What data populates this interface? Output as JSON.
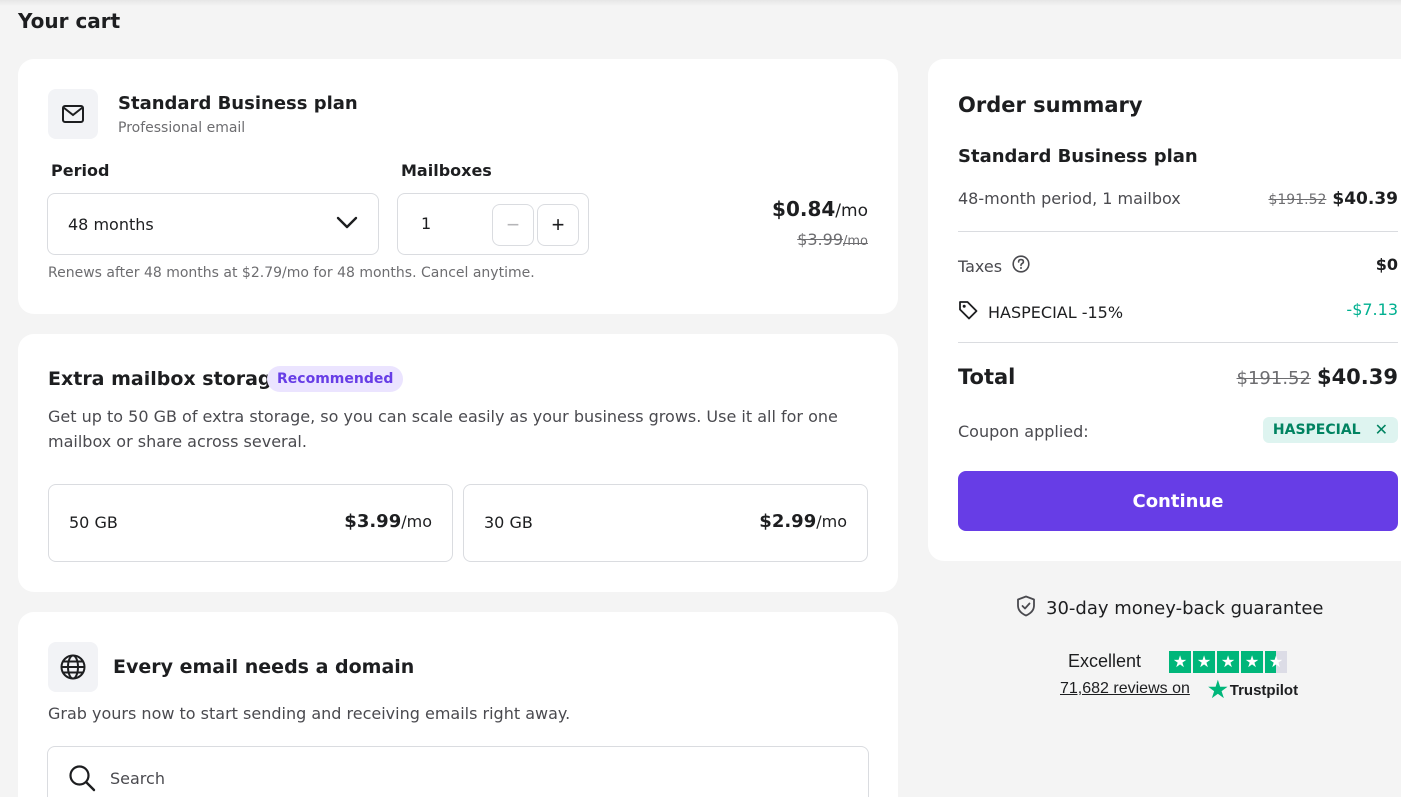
{
  "page": {
    "title": "Your cart"
  },
  "plan": {
    "name": "Standard Business plan",
    "subtitle": "Professional email",
    "period_label": "Period",
    "period_value": "48 months",
    "mailboxes_label": "Mailboxes",
    "mailboxes_value": "1",
    "minus": "−",
    "plus": "+",
    "price": "$0.84",
    "price_unit": "/mo",
    "old_price": "$3.99",
    "old_price_unit": "/mo",
    "renews_text": "Renews after 48 months at $2.79/mo for 48 months. Cancel anytime."
  },
  "storage": {
    "title": "Extra mailbox storage",
    "badge": "Recommended",
    "description": "Get up to 50 GB of extra storage, so you can scale easily as your business grows. Use it all for one mailbox or share across several.",
    "options": [
      {
        "size": "50 GB",
        "price": "$3.99",
        "unit": "/mo"
      },
      {
        "size": "30 GB",
        "price": "$2.99",
        "unit": "/mo"
      }
    ]
  },
  "domain": {
    "title": "Every email needs a domain",
    "description": "Grab yours now to start sending and receiving emails right away.",
    "search_placeholder": "Search"
  },
  "summary": {
    "title": "Order summary",
    "plan_name": "Standard Business plan",
    "plan_detail": "48-month period, 1 mailbox",
    "plan_old_price": "$191.52",
    "plan_price": "$40.39",
    "taxes_label": "Taxes",
    "taxes_value": "$0",
    "discount_label": "HASPECIAL -15%",
    "discount_value": "-$7.13",
    "total_label": "Total",
    "total_old": "$191.52",
    "total_value": "$40.39",
    "coupon_label": "Coupon applied:",
    "coupon_code": "HASPECIAL",
    "coupon_remove": "✕",
    "continue_label": "Continue"
  },
  "guarantee": {
    "text": "30-day money-back guarantee"
  },
  "trustpilot": {
    "rating_text": "Excellent",
    "rating": 4.5,
    "max": 5,
    "reviews_text": "71,682 reviews on",
    "brand": "Trustpilot"
  },
  "colors": {
    "accent": "#673de6",
    "success": "#00b67a",
    "discount_green": "#00b090"
  }
}
